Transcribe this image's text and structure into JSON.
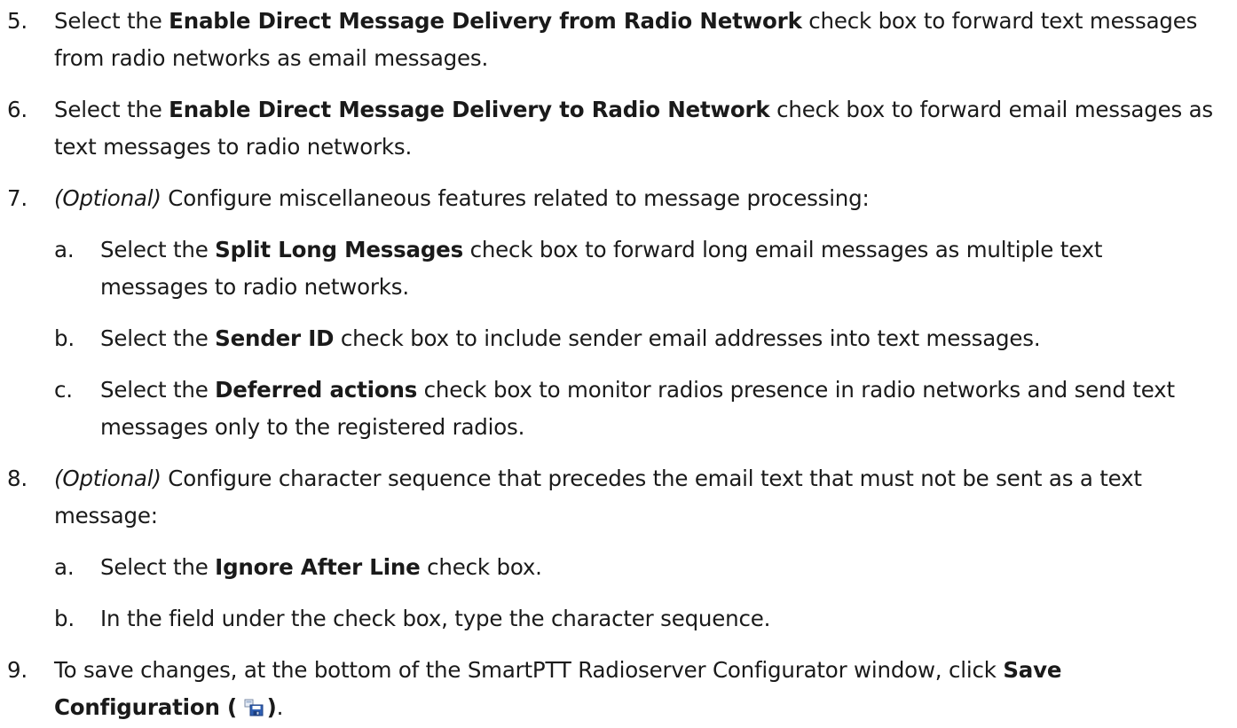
{
  "steps": [
    {
      "num": "5.",
      "pre": "Select the ",
      "bold": "Enable Direct Message Delivery from Radio Network",
      "post": " check box to forward text messages from radio networks as email messages."
    },
    {
      "num": "6.",
      "pre": "Select the ",
      "bold": "Enable Direct Message Delivery to Radio Network",
      "post": " check box to forward email messages as text messages to radio networks."
    },
    {
      "num": "7.",
      "italic": "(Optional)",
      "text": " Configure miscellaneous features related to message processing:",
      "subs": [
        {
          "num": "a.",
          "pre": "Select the ",
          "bold": "Split Long Messages",
          "post": " check box to forward long email messages as multiple text messages to radio networks."
        },
        {
          "num": "b.",
          "pre": "Select the ",
          "bold": "Sender ID",
          "post": " check box to include sender email addresses into text messages."
        },
        {
          "num": "c.",
          "pre": "Select the ",
          "bold": "Deferred actions",
          "post": " check box to monitor radios presence in radio networks and send text messages only to the registered radios."
        }
      ]
    },
    {
      "num": "8.",
      "italic": "(Optional)",
      "text": " Configure character sequence that precedes the email text that must not be sent as a text message:",
      "subs": [
        {
          "num": "a.",
          "pre": "Select the ",
          "bold": "Ignore After Line",
          "post": " check box."
        },
        {
          "num": "b.",
          "text": "In the field under the check box, type the character sequence."
        }
      ]
    },
    {
      "num": "9.",
      "pre": "To save changes, at the bottom of the SmartPTT Radioserver Configurator window, click ",
      "bold_open": "Save Configuration (",
      "icon": "save-configuration-icon",
      "bold_close": ")",
      "post": "."
    }
  ]
}
